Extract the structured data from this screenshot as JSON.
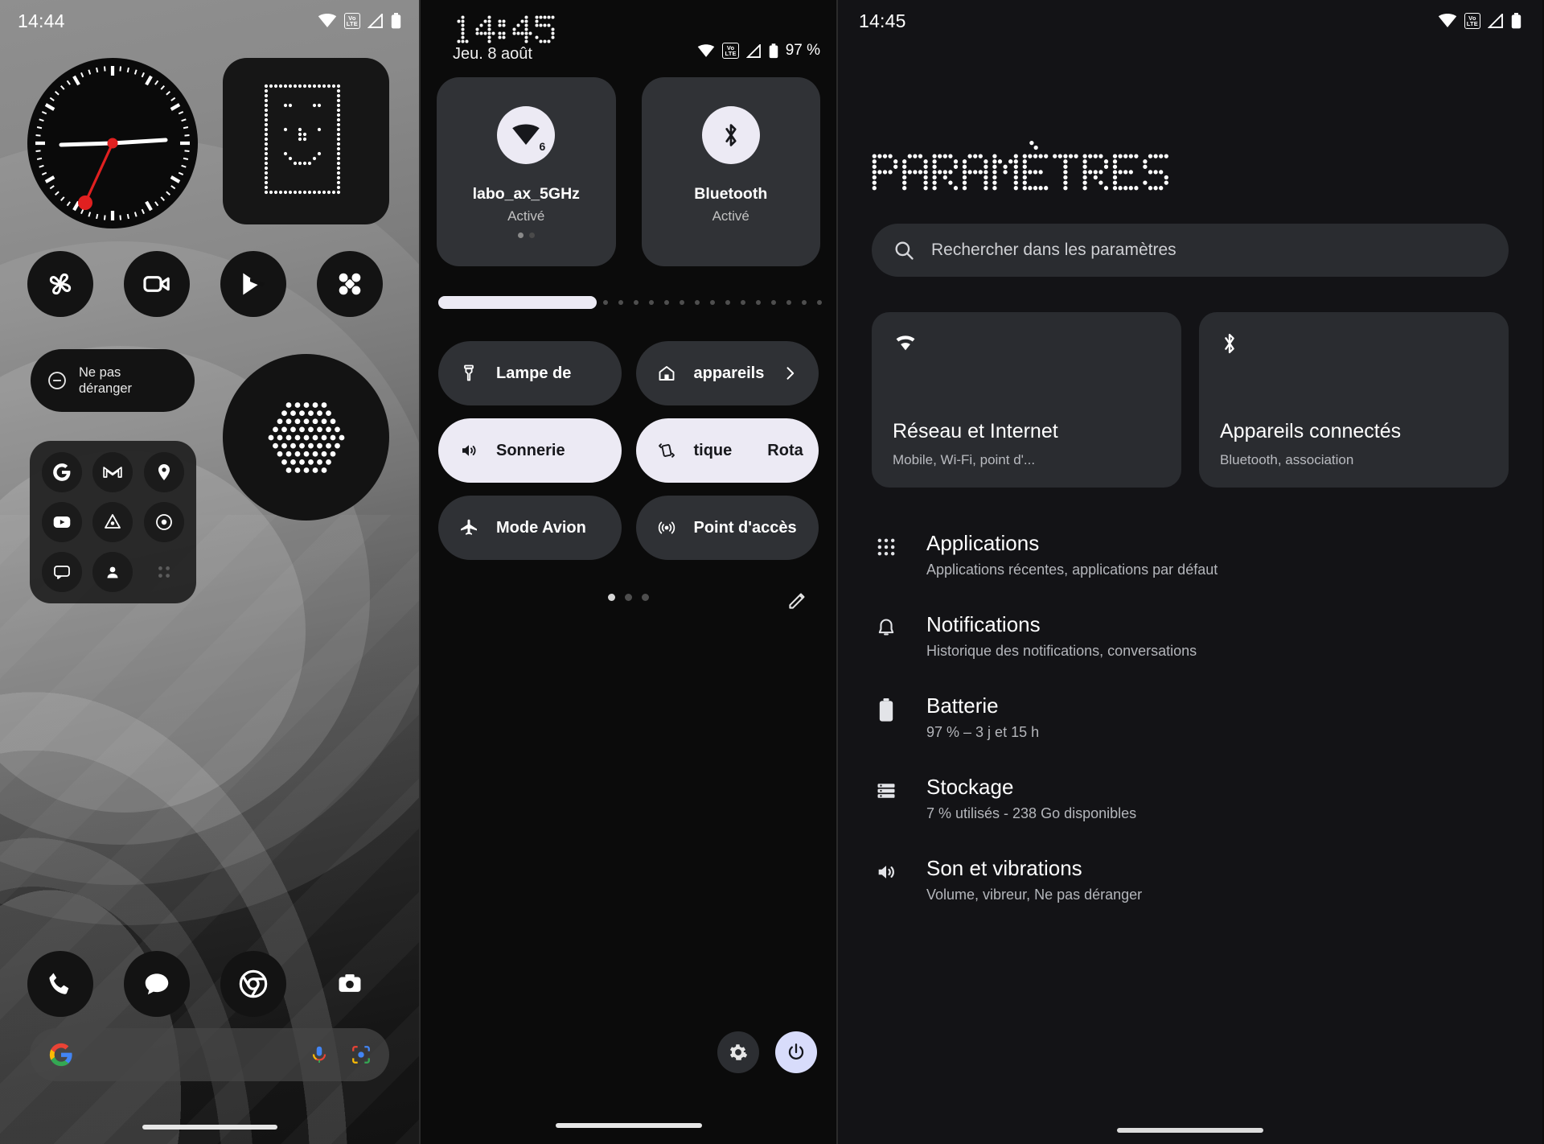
{
  "home": {
    "status": {
      "time": "14:44",
      "volte": "Vo LTE"
    },
    "widgets": {
      "clock_name": "analog-clock-widget",
      "phone_widget_name": "pixel-face-widget"
    },
    "dnd": {
      "label": "Ne pas\ndéranger",
      "line1": "Ne pas",
      "line2": "déranger"
    },
    "app_row": [
      "fan-icon",
      "camcorder-icon",
      "play-store-icon",
      "connections-icon"
    ],
    "folder_icons": [
      "google-g-icon",
      "gmail-icon",
      "maps-pin-icon",
      "youtube-icon",
      "drive-icon",
      "photos-icon",
      "chat-bubble-icon",
      "contacts-icon",
      "apps-grid-icon"
    ],
    "dock": [
      "phone-icon",
      "messages-icon",
      "chrome-icon",
      "camera-icon"
    ],
    "search": {
      "placeholder": "",
      "logo": "google-logo",
      "mic": "mic-icon",
      "lens": "lens-icon"
    }
  },
  "quick_settings": {
    "clock": "14:45",
    "date": "Jeu. 8 août",
    "status": {
      "battery_pct": "97 %",
      "volte": "Vo LTE"
    },
    "big_tiles": [
      {
        "name": "wifi-tile",
        "icon": "wifi-6-icon",
        "label": "labo_ax_5GHz",
        "sub": "Activé",
        "active": true,
        "badge": "6"
      },
      {
        "name": "bluetooth-tile",
        "icon": "bluetooth-icon",
        "label": "Bluetooth",
        "sub": "Activé",
        "active": true
      }
    ],
    "brightness": {
      "name": "brightness-slider",
      "value": 40
    },
    "tiles": [
      {
        "name": "flashlight-tile",
        "icon": "flashlight-icon",
        "label": "Lampe de",
        "on": false,
        "chevron": false
      },
      {
        "name": "devices-tile",
        "icon": "home-icon",
        "label": "appareils",
        "on": false,
        "chevron": true
      },
      {
        "name": "ringer-tile",
        "icon": "volume-icon",
        "label": "Sonnerie",
        "on": true,
        "chevron": false
      },
      {
        "name": "rotation-tile",
        "icon": "rotate-icon",
        "label": "tique",
        "label2": "Rota",
        "on": true,
        "chevron": false
      },
      {
        "name": "airplane-tile",
        "icon": "airplane-icon",
        "label": "Mode Avion",
        "on": false,
        "chevron": false
      },
      {
        "name": "hotspot-tile",
        "icon": "hotspot-icon",
        "label": "Point d'accès",
        "on": false,
        "chevron": false
      }
    ],
    "page_dots": {
      "count": 3,
      "active": 0
    },
    "edit_icon": "pencil-icon",
    "footer": [
      {
        "name": "settings-button",
        "icon": "gear-icon",
        "accent": false
      },
      {
        "name": "power-button",
        "icon": "power-icon",
        "accent": true
      }
    ]
  },
  "settings": {
    "status": {
      "time": "14:45",
      "volte": "Vo LTE"
    },
    "title": "PARAMÈTRES",
    "search": {
      "placeholder": "Rechercher dans les paramètres",
      "icon": "search-icon"
    },
    "cards": [
      {
        "name": "network-card",
        "icon": "wifi-icon",
        "title": "Réseau et Internet",
        "sub": "Mobile, Wi-Fi, point d'..."
      },
      {
        "name": "devices-card",
        "icon": "bluetooth-icon",
        "title": "Appareils connectés",
        "sub": "Bluetooth, association"
      }
    ],
    "rows": [
      {
        "name": "settings-row-applications",
        "icon": "apps-grid-icon",
        "title": "Applications",
        "sub": "Applications récentes, applications par défaut"
      },
      {
        "name": "settings-row-notifications",
        "icon": "bell-icon",
        "title": "Notifications",
        "sub": "Historique des notifications, conversations"
      },
      {
        "name": "settings-row-battery",
        "icon": "battery-icon",
        "title": "Batterie",
        "sub": "97 % – 3 j et 15 h"
      },
      {
        "name": "settings-row-storage",
        "icon": "storage-icon",
        "title": "Stockage",
        "sub": "7 % utilisés - 238 Go disponibles"
      },
      {
        "name": "settings-row-sound",
        "icon": "volume-icon",
        "title": "Son et vibrations",
        "sub": "Volume, vibreur, Ne pas déranger"
      }
    ]
  },
  "colors": {
    "accent_light": "#eceaf4",
    "tile_dark": "#2f3135",
    "panel_bg": "#131316",
    "qs_bg": "#0b0b0b"
  }
}
